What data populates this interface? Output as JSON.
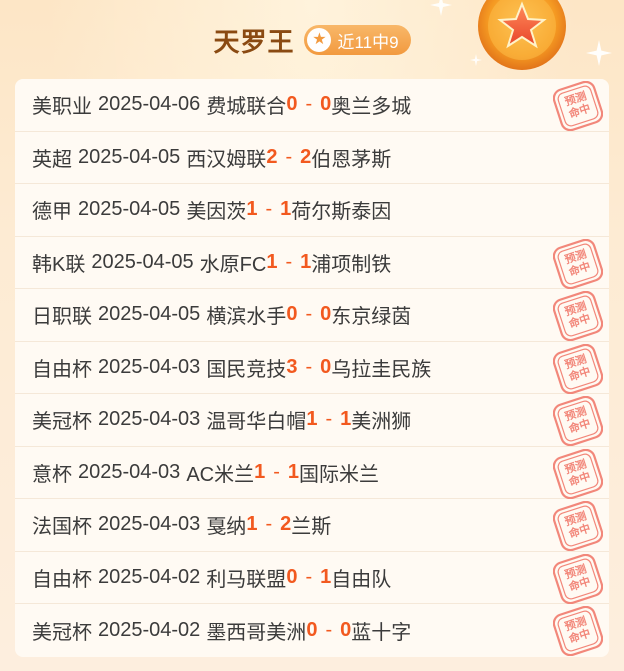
{
  "header": {
    "title": "天罗王",
    "badge_text": "近11中9",
    "badge_icon": "star-icon",
    "medal_icon": "star-medal-icon"
  },
  "colors": {
    "accent": "#f29a3f",
    "score": "#f2591f",
    "title": "#8a4a12",
    "stamp": "#f2877a"
  },
  "stamp_text": [
    "预测",
    "命中"
  ],
  "matches": [
    {
      "league": "美职业",
      "date": "2025-04-06",
      "home": "费城联合",
      "home_score": "0",
      "away_score": "0",
      "away": "奥兰多城",
      "hit": true
    },
    {
      "league": "英超",
      "date": "2025-04-05",
      "home": "西汉姆联",
      "home_score": "2",
      "away_score": "2",
      "away": "伯恩茅斯",
      "hit": false
    },
    {
      "league": "德甲",
      "date": "2025-04-05",
      "home": "美因茨",
      "home_score": "1",
      "away_score": "1",
      "away": "荷尔斯泰因",
      "hit": false
    },
    {
      "league": "韩K联",
      "date": "2025-04-05",
      "home": "水原FC",
      "home_score": "1",
      "away_score": "1",
      "away": "浦项制铁",
      "hit": true
    },
    {
      "league": "日职联",
      "date": "2025-04-05",
      "home": "横滨水手",
      "home_score": "0",
      "away_score": "0",
      "away": "东京绿茵",
      "hit": true
    },
    {
      "league": "自由杯",
      "date": "2025-04-03",
      "home": "国民竞技",
      "home_score": "3",
      "away_score": "0",
      "away": "乌拉圭民族",
      "hit": true
    },
    {
      "league": "美冠杯",
      "date": "2025-04-03",
      "home": "温哥华白帽",
      "home_score": "1",
      "away_score": "1",
      "away": "美洲狮",
      "hit": true
    },
    {
      "league": "意杯",
      "date": "2025-04-03",
      "home": "AC米兰",
      "home_score": "1",
      "away_score": "1",
      "away": "国际米兰",
      "hit": true
    },
    {
      "league": "法国杯",
      "date": "2025-04-03",
      "home": "戛纳",
      "home_score": "1",
      "away_score": "2",
      "away": "兰斯",
      "hit": true
    },
    {
      "league": "自由杯",
      "date": "2025-04-02",
      "home": "利马联盟",
      "home_score": "0",
      "away_score": "1",
      "away": "自由队",
      "hit": true
    },
    {
      "league": "美冠杯",
      "date": "2025-04-02",
      "home": "墨西哥美洲",
      "home_score": "0",
      "away_score": "0",
      "away": "蓝十字",
      "hit": true
    }
  ]
}
